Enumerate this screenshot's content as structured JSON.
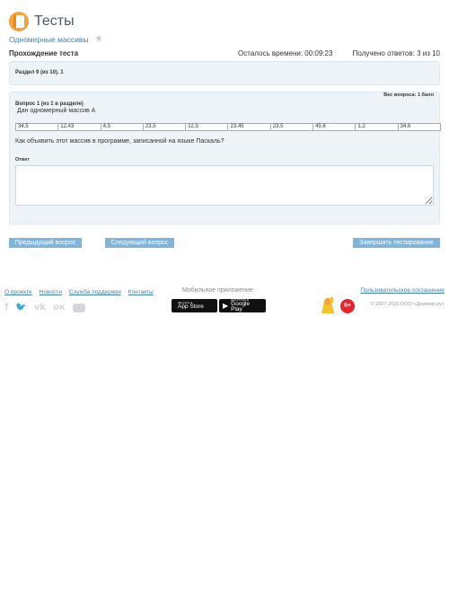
{
  "header": {
    "app_title": "Тесты",
    "logo_icon": "book-logo-icon",
    "accent": "#f6a23a"
  },
  "breadcrumb": {
    "label": "Одномерные массивы",
    "favorite_icon": "star-icon"
  },
  "status": {
    "title": "Прохождение теста",
    "time_left": "Осталось времени: 00:09:23",
    "answers": "Получено ответов: 3 из 10"
  },
  "section": {
    "label": "Раздел 9 (из 10). 1"
  },
  "question": {
    "weight": "Вес вопроса: 1 балл",
    "header": "Вопрос 1 (из 1 в разделе)",
    "subtitle": "Дан одномерный массив А",
    "values": [
      "34,5",
      "12,43",
      "4,5",
      "23,5",
      "12,5",
      "23,45",
      "23,5",
      "45,6",
      "1,2",
      "34,6"
    ],
    "text": "Как объявить этот массив в программе, записанной на языке Паскаль?",
    "answer_label": "Ответ",
    "answer_value": ""
  },
  "navigation": {
    "prev": "Предыдущий вопрос",
    "next": "Следующий вопрос",
    "finish": "Завершить тестирование",
    "button_color": "#7fb4dd"
  },
  "footer": {
    "links": [
      "О проекте",
      "Новости",
      "Служба поддержки",
      "Контакты"
    ],
    "social_icons": [
      "facebook-icon",
      "twitter-icon",
      "vk-icon",
      "odnoklassniki-icon",
      "youtube-icon"
    ],
    "mobile_title": "Мобильное приложение",
    "appstore_small": "Загрузите в",
    "appstore_big": "App Store",
    "gplay_small": "ДОСТУПНО В",
    "gplay_big": "Google Play",
    "age_rating": "6+",
    "user_agreement": "Пользовательское соглашение",
    "copyright": "© 2007-2020 ООО «Дневник.ру»"
  }
}
